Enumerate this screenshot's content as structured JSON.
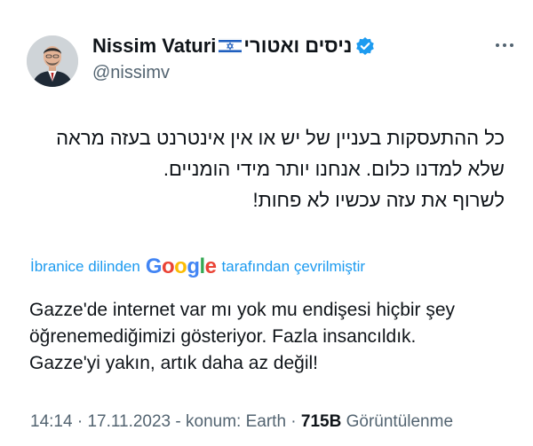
{
  "tweet": {
    "author": {
      "display_name": "Nissim Vaturi",
      "flag_icon": "israel-flag-icon",
      "hebrew_name": "ניסים ואטורי",
      "handle": "@nissimv",
      "verified_badge_color": "#1d9bf0"
    },
    "more_icon": "more-options-icon",
    "text_lines": [
      "כל ההתעסקות בעניין של יש או אין אינטרנט בעזה מראה",
      "שלא למדנו כלום. אנחנו יותר מידי הומניים.",
      "לשרוף את עזה עכשיו לא פחות!"
    ],
    "translation": {
      "prefix": "İbranice dilinden",
      "provider": "Google",
      "suffix": "tarafından çevrilmiştir",
      "lines": [
        "Gazze'de internet var mı yok mu endişesi hiçbir şey",
        "öğrenemediğimizi gösteriyor. Fazla insancıldık.",
        "Gazze'yi yakın, artık daha az değil!"
      ]
    },
    "meta": {
      "time": "14:14",
      "date": "17.11.2023",
      "location": "konum: Earth",
      "views": "715B",
      "views_label": "Görüntülenme"
    }
  },
  "colors": {
    "text": "#0f1419",
    "secondary": "#536471",
    "link": "#1d9bf0",
    "google_blue": "#4285f4",
    "google_red": "#ea4335",
    "google_yellow": "#fbbc05",
    "google_green": "#34a853"
  }
}
